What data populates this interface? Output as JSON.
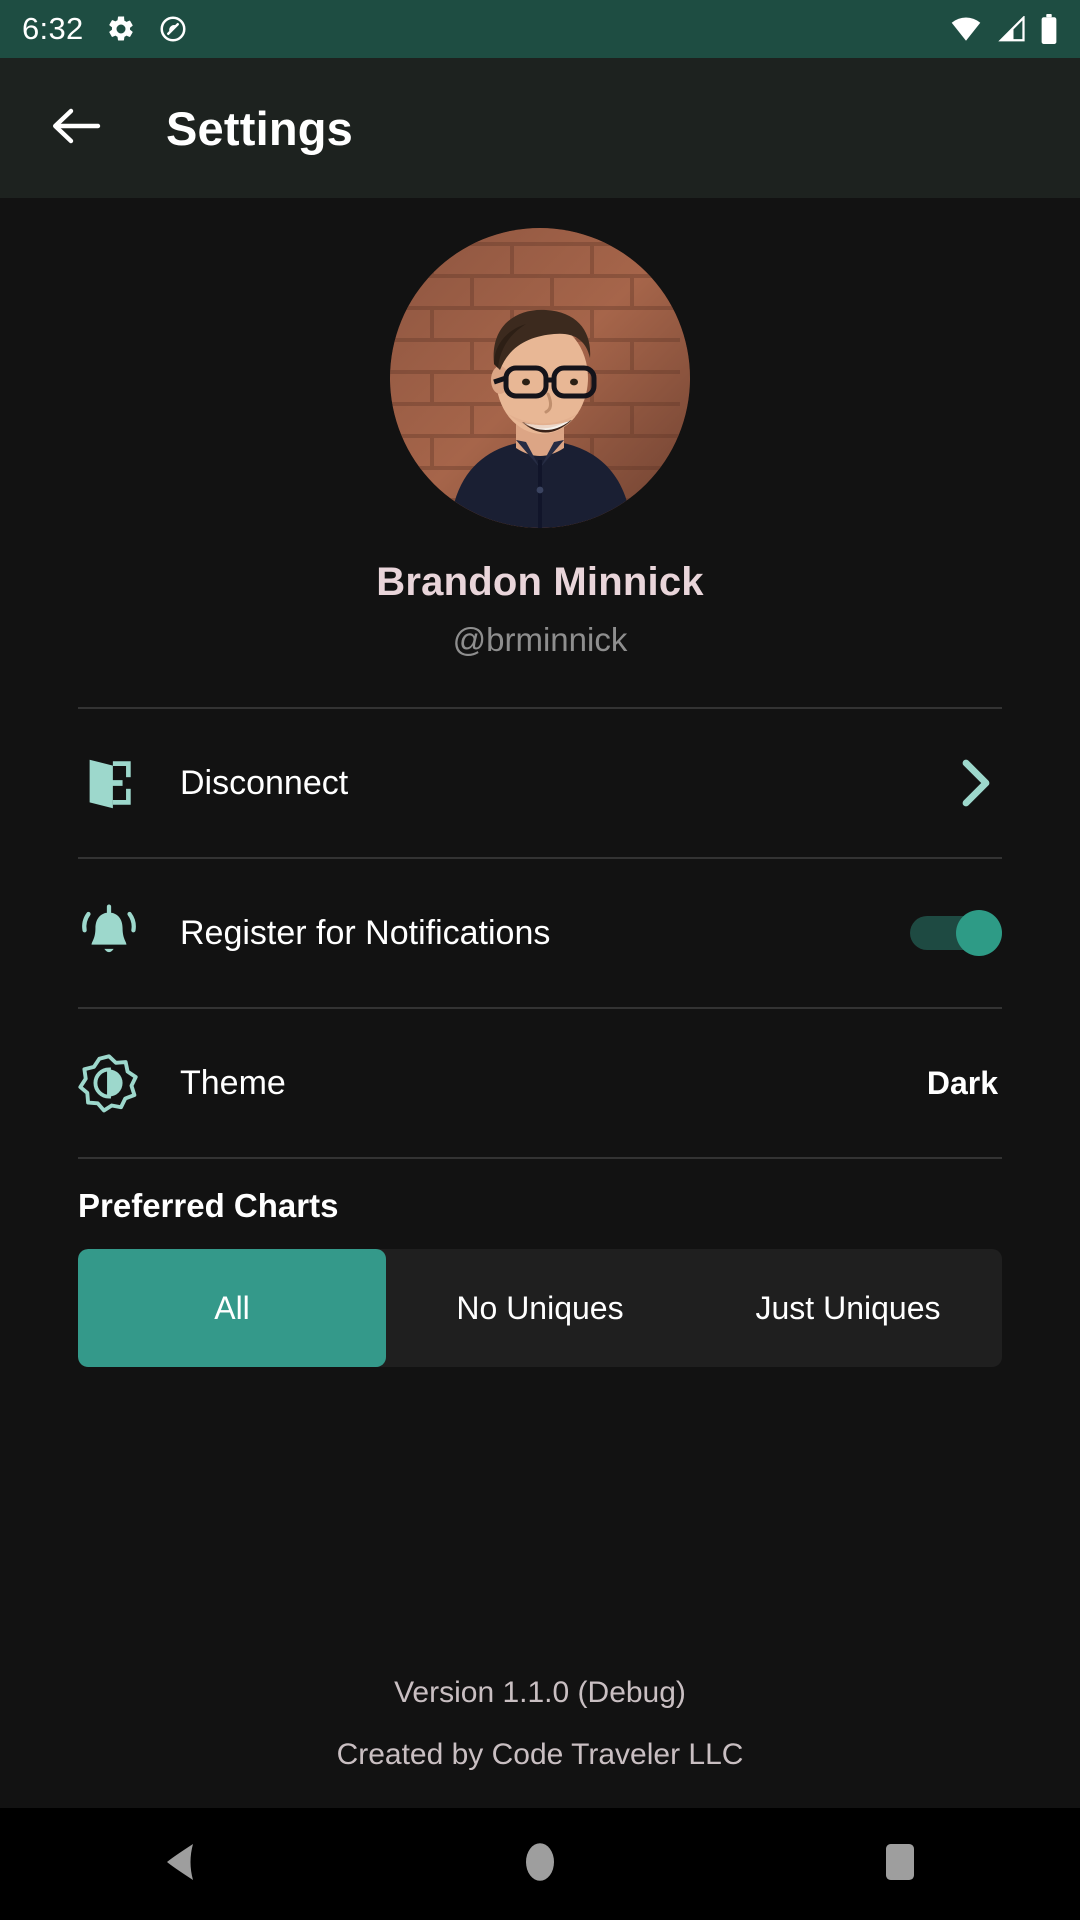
{
  "status_bar": {
    "time": "6:32",
    "icons": [
      "gear-icon",
      "do-not-disturb-icon",
      "wifi-icon",
      "cellular-signal-icon",
      "battery-icon"
    ],
    "background_color": "#1E4D42"
  },
  "app_bar": {
    "back_label": "back-arrow-icon",
    "title": "Settings",
    "background_color": "#1D221F"
  },
  "profile": {
    "avatar_alt": "user-avatar",
    "name": "Brandon Minnick",
    "handle": "@brminnick",
    "name_color": "#E9D5DA",
    "handle_color": "#8E8E8E"
  },
  "settings": {
    "rows": [
      {
        "id": "disconnect",
        "icon": "logout-door-icon",
        "label": "Disconnect",
        "accessory": "chevron-right-icon"
      },
      {
        "id": "notifications",
        "icon": "bell-ringing-icon",
        "label": "Register for Notifications",
        "accessory": "toggle",
        "toggle_on": true
      },
      {
        "id": "theme",
        "icon": "theme-brightness-icon",
        "label": "Theme",
        "accessory": "value",
        "value": "Dark"
      }
    ]
  },
  "preferred_charts": {
    "title": "Preferred Charts",
    "options": [
      "All",
      "No Uniques",
      "Just Uniques"
    ],
    "selected_index": 0,
    "selected_color": "#34998A",
    "track_color": "#1F1F1F"
  },
  "footer": {
    "version": "Version 1.1.0 (Debug)",
    "credit": "Created by Code Traveler LLC"
  },
  "nav_bar": {
    "back": "nav-back-icon",
    "home": "nav-home-icon",
    "recents": "nav-recents-icon",
    "icon_color": "#9E9E9E"
  },
  "colors": {
    "accent_teal": "#2E9B86",
    "accent_mint": "#9DD8CC",
    "page_background": "#121212"
  }
}
